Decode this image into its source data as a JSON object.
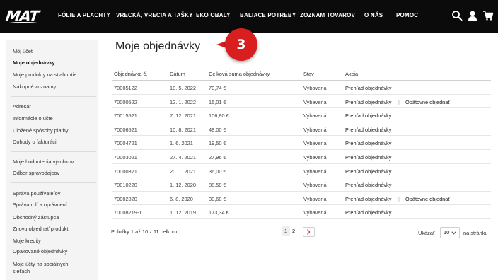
{
  "header": {
    "logo_text": "MAT",
    "nav": [
      {
        "label": "FÓLIE A PLACHTY"
      },
      {
        "label": "VRECKÁ, VRECIA A TAŠKY"
      },
      {
        "label": "EKO OBALY"
      },
      {
        "label": "BALIACE POTREBY"
      },
      {
        "label": "ZOZNAM TOVAROV"
      },
      {
        "label": "O NÁS"
      },
      {
        "label": "POMOC"
      }
    ],
    "icons": [
      "search-icon",
      "user-icon",
      "cart-icon"
    ]
  },
  "sidebar": {
    "groups": [
      [
        "Môj účet",
        "Moje objednávky",
        "Moje produkty na stiahnutie",
        "Nákupné zoznamy"
      ],
      [
        "Adresár",
        "Informácie o účte",
        "Uložené spôsoby platby",
        "Dohody o fakturácii"
      ],
      [
        "Moje hodnotenia výrobkov",
        "Odber spravodajcov"
      ],
      [
        "Správa používateľov",
        "Správa rolí a oprávnení",
        "Obchodný zástupca",
        "Znovu objednať produkt",
        "Moje kredity",
        "Opakované objednávky",
        "Moje účty na sociálnych",
        "sieťach"
      ]
    ],
    "active": "Moje objednávky"
  },
  "main": {
    "title": "Moje objednávky",
    "callout_number": "3",
    "columns": [
      "Objednávka č.",
      "Dátum",
      "Celková suma objednávky",
      "Stav",
      "Akcia"
    ],
    "rows": [
      {
        "order": "70005122",
        "date": "18. 5. 2022",
        "total": "70,74 €",
        "status": "Vybavená",
        "action": "Prehľad objednávky",
        "reorder": ""
      },
      {
        "order": "70000522",
        "date": "12. 1. 2022",
        "total": "15,01 €",
        "status": "Vybavená",
        "action": "Prehľad objednávky",
        "reorder": "Opätovne objednať"
      },
      {
        "order": "70015521",
        "date": "7. 12. 2021",
        "total": "106,80 €",
        "status": "Vybavená",
        "action": "Prehľad objednávky",
        "reorder": ""
      },
      {
        "order": "70006521",
        "date": "10. 8. 2021",
        "total": "48,00 €",
        "status": "Vybavená",
        "action": "Prehľad objednávky",
        "reorder": ""
      },
      {
        "order": "70004721",
        "date": "1. 6. 2021",
        "total": "19,50 €",
        "status": "Vybavená",
        "action": "Prehľad objednávky",
        "reorder": ""
      },
      {
        "order": "70003021",
        "date": "27. 4. 2021",
        "total": "27,96 €",
        "status": "Vybavená",
        "action": "Prehľad objednávky",
        "reorder": ""
      },
      {
        "order": "70000321",
        "date": "20. 1. 2021",
        "total": "36,00 €",
        "status": "Vybavená",
        "action": "Prehľad objednávky",
        "reorder": ""
      },
      {
        "order": "70010220",
        "date": "1. 12. 2020",
        "total": "88,50 €",
        "status": "Vybavená",
        "action": "Prehľad objednávky",
        "reorder": ""
      },
      {
        "order": "70002820",
        "date": "6. 8. 2020",
        "total": "30,60 €",
        "status": "Vybavená",
        "action": "Prehľad objednávky",
        "reorder": "Opätovne objednať"
      },
      {
        "order": "70008219-1",
        "date": "1. 12. 2019",
        "total": "173,34 €",
        "status": "Vybavená",
        "action": "Prehľad objednávky",
        "reorder": ""
      }
    ]
  },
  "pagination": {
    "summary": "Položky 1 až 10 z 11 celkom",
    "pages": [
      "1",
      "2"
    ],
    "current_page": "1",
    "show_label": "Ukázať",
    "per_page": "10",
    "per_page_suffix": "na stránku"
  },
  "colors": {
    "topbar": "#0b0b0b",
    "sidebar": "#f4f4f4",
    "callout": "#d81e1e"
  }
}
